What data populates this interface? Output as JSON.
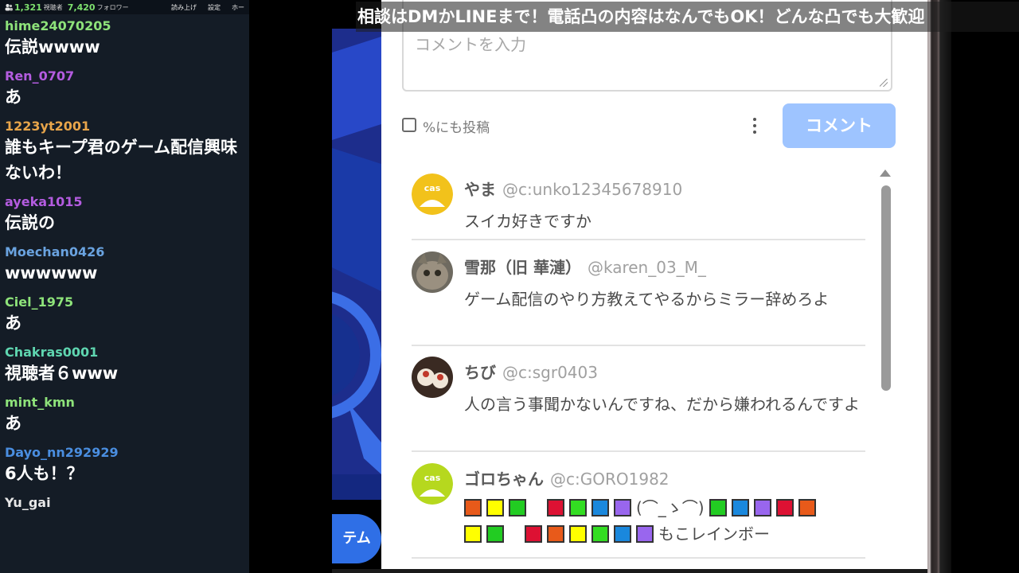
{
  "chat": {
    "viewer_count": "1,321",
    "viewer_label": "視聴者",
    "follower_count": "7,420",
    "follower_label": "フォロワー",
    "links": [
      "読み上げ",
      "設定",
      "ホー"
    ],
    "messages": [
      {
        "user": "hime24070205",
        "text": "伝説wwww",
        "color": "#8ee37a"
      },
      {
        "user": "Ren_0707",
        "text": "あ",
        "color": "#b45ce0"
      },
      {
        "user": "1223yt2001",
        "text": "誰もキープ君のゲーム配信興味ないわ！",
        "color": "#e8a54a"
      },
      {
        "user": "ayeka1015",
        "text": "伝説の",
        "color": "#b45ce0"
      },
      {
        "user": "Moechan0426",
        "text": "wwwwww",
        "color": "#6aa3e0"
      },
      {
        "user": "Ciel_1975",
        "text": "あ",
        "color": "#8ee37a"
      },
      {
        "user": "Chakras0001",
        "text": "視聴者６www",
        "color": "#5fd6b0"
      },
      {
        "user": "mint_kmn",
        "text": "あ",
        "color": "#8ee37a"
      },
      {
        "user": "Dayo_nn292929",
        "text": "6人も！？",
        "color": "#4a8ee0"
      },
      {
        "user": "Yu_gai",
        "text": "",
        "color": "#e8e8e8"
      }
    ]
  },
  "capture": {
    "side_button": "テム",
    "input_placeholder": "コメントを入力",
    "also_post_label": "%にも投稿",
    "submit_label": "コメント",
    "comments": [
      {
        "name": "やま",
        "handle": "@c:unko12345678910",
        "text": "スイカ好きですか"
      },
      {
        "name": "雪那（旧 華漣）",
        "handle": "@karen_03_M_",
        "text": "ゲーム配信のやり方教えてやるからミラー辞めろよ"
      },
      {
        "name": "ちび",
        "handle": "@c:sgr0403",
        "text": "人の言う事聞かないんですね、だから嫌われるんですよ"
      },
      {
        "name": "ゴロちゃん",
        "handle": "@c:GORO1982",
        "kaomoji": "(⌒_ゝ⌒)",
        "trailing": "もこレインボー"
      }
    ],
    "rainbow_row1": [
      "#e85a1a",
      "#ffff00",
      "#22cc22",
      "#ffffff",
      "#dd1133",
      "#33dd22",
      "#1a88dd",
      "#9966ee"
    ],
    "rainbow_row1b": [
      "#22cc22",
      "#1a88dd",
      "#9966ee",
      "#dd1133",
      "#e85a1a"
    ],
    "rainbow_row2": [
      "#ffff00",
      "#22cc22",
      "#ffffff",
      "#dd1133",
      "#e85a1a",
      "#ffff00",
      "#33dd22",
      "#1a88dd",
      "#9966ee"
    ]
  },
  "banner": {
    "text": "相談はDMかLINEまで！電話凸の内容はなんでもOK！どんな凸でも大歓迎"
  }
}
